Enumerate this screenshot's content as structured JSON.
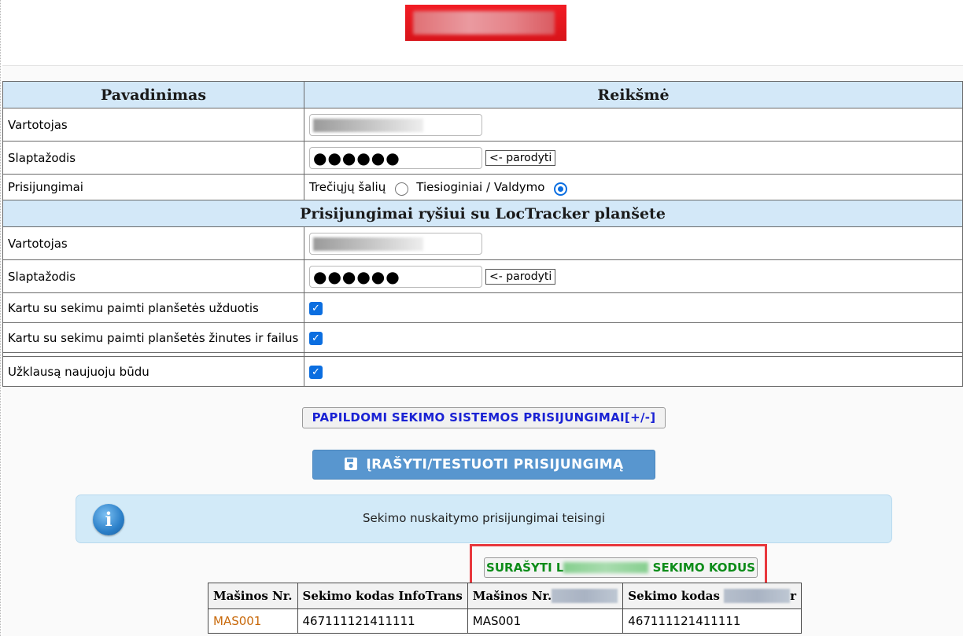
{
  "header": {
    "logo_alt": "logo"
  },
  "table": {
    "col_name": "Pavadinimas",
    "col_value": "Reikšmė",
    "rows": {
      "user_label": "Vartotojas",
      "user_value": "",
      "pass_label": "Slaptažodis",
      "pass_value": "●●●●●●",
      "show_label": "<- parodyti",
      "connections_label": "Prisijungimai",
      "radio_third": "Trečiųjų šalių",
      "radio_direct": "Tiesioginiai / Valdymo",
      "radio_selected": "Tiesioginiai / Valdymo"
    },
    "section2_title": "Prisijungimai ryšiui su LocTracker planšete",
    "rows2": {
      "user_label": "Vartotojas",
      "user_value": "",
      "pass_label": "Slaptažodis",
      "pass_value": "●●●●●●",
      "show_label": "<- parodyti",
      "tasks_label": "Kartu su sekimu paimti planšetės užduotis",
      "tasks_checked": true,
      "messages_label": "Kartu su sekimu paimti planšetės žinutes ir failus",
      "messages_checked": true,
      "newmode_label": "Užklausą naujuoju būdu",
      "newmode_checked": true
    }
  },
  "buttons": {
    "extra_connections": "PAPILDOMI SEKIMO SISTEMOS PRISIJUNGIMAI[+/-]",
    "save_test": "ĮRAŠYTI/TESTUOTI PRISIJUNGIMĄ",
    "codes_prefix": "SURAŠYTI L",
    "codes_suffix": "SEKIMO KODUS"
  },
  "info": {
    "message": "Sekimo nuskaitymo prisijungimai teisingi"
  },
  "codes_table": {
    "headers": [
      "Mašinos Nr.",
      "Sekimo kodas InfoTrans",
      "Mašinos Nr.",
      "Sekimo kodas "
    ],
    "header4_tail": "r",
    "rows": [
      [
        "MAS001",
        "467111121411111",
        "MAS001",
        "467111121411111"
      ]
    ]
  },
  "colors": {
    "header_bg": "#d3e8f8",
    "link_blue": "#1a22d4",
    "save_btn": "#5896cf",
    "info_bg": "#d2eaf8",
    "highlight_frame": "#e8383d",
    "codes_green": "#0d8c19",
    "link_orange": "#c8690b"
  }
}
